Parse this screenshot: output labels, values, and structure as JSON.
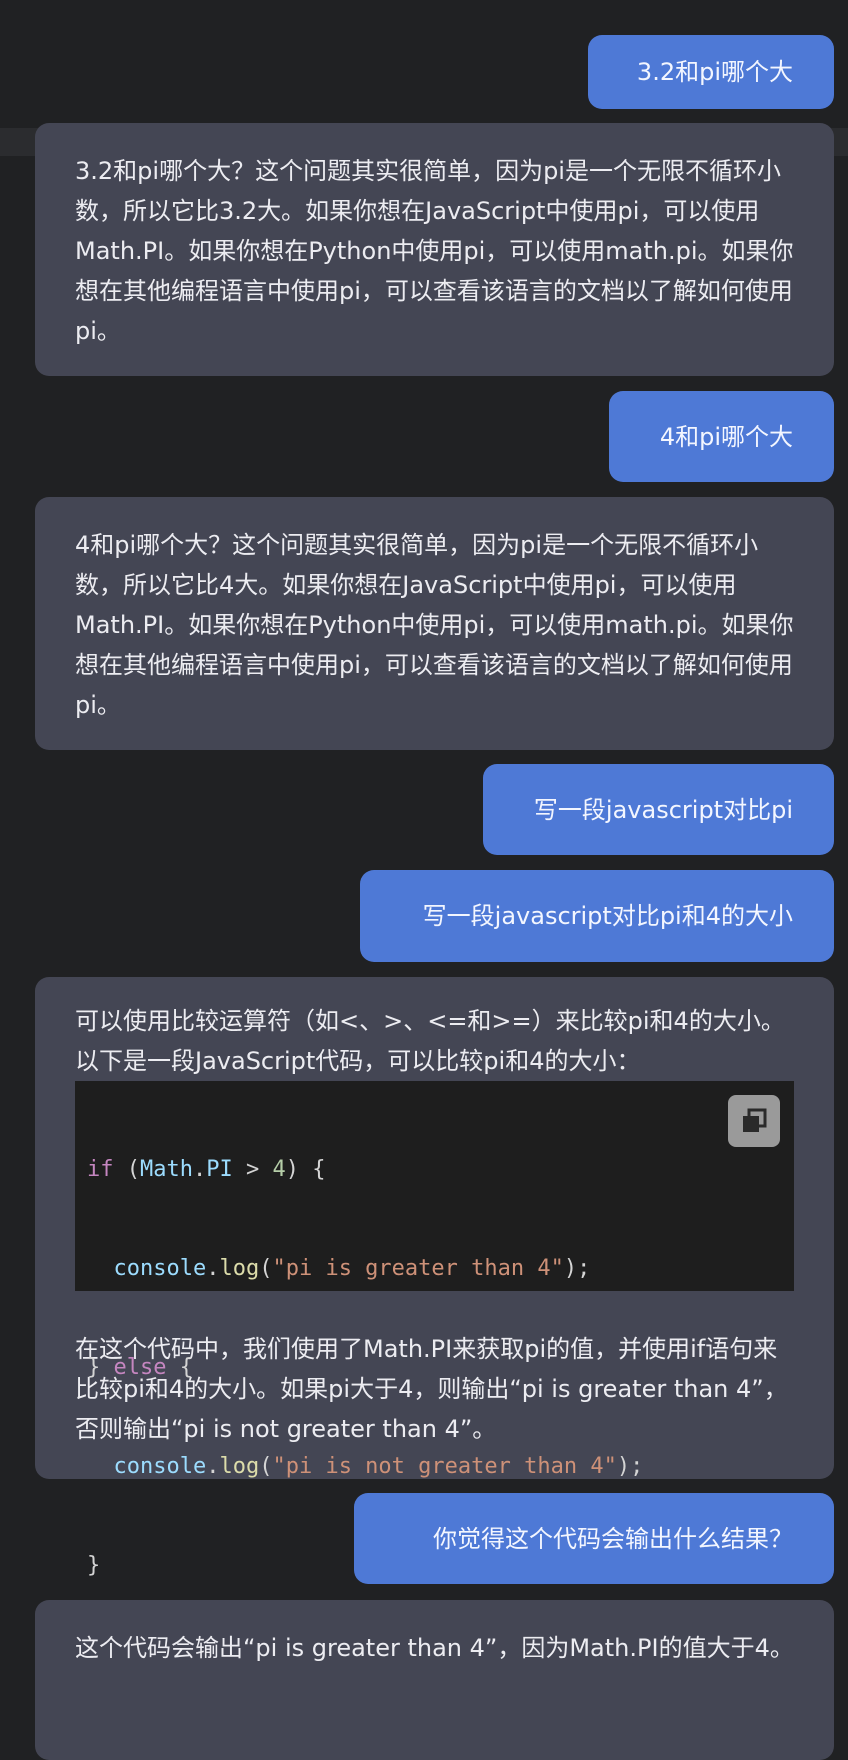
{
  "messages": [
    {
      "role": "user",
      "text": "3.2和pi哪个大"
    },
    {
      "role": "assistant",
      "text": "3.2和pi哪个大？这个问题其实很简单，因为pi是一个无限不循环小数，所以它比3.2大。如果你想在JavaScript中使用pi，可以使用Math.PI。如果你想在Python中使用pi，可以使用math.pi。如果你想在其他编程语言中使用pi，可以查看该语言的文档以了解如何使用pi。"
    },
    {
      "role": "user",
      "text": "4和pi哪个大"
    },
    {
      "role": "assistant",
      "text": "4和pi哪个大？这个问题其实很简单，因为pi是一个无限不循环小数，所以它比4大。如果你想在JavaScript中使用pi，可以使用Math.PI。如果你想在Python中使用pi，可以使用math.pi。如果你想在其他编程语言中使用pi，可以查看该语言的文档以了解如何使用pi。"
    },
    {
      "role": "user",
      "text": "写一段javascript对比pi"
    },
    {
      "role": "user",
      "text": "写一段javascript对比pi和4的大小"
    },
    {
      "role": "assistant",
      "intro": "可以使用比较运算符（如<、>、<=和>=）来比较pi和4的大小。以下是一段JavaScript代码，可以比较pi和4的大小：",
      "code_lines": [
        "if (Math.PI > 4) {",
        "  console.log(\"pi is greater than 4\");",
        "} else {",
        "  console.log(\"pi is not greater than 4\");",
        "}"
      ],
      "outro": "在这个代码中，我们使用了Math.PI来获取pi的值，并使用if语句来比较pi和4的大小。如果pi大于4，则输出“pi is greater than 4”，否则输出“pi is not greater than 4”。",
      "copy_icon": "copy-icon"
    },
    {
      "role": "user",
      "text": "你觉得这个代码会输出什么结果？"
    },
    {
      "role": "assistant",
      "text": "这个代码会输出“pi is greater than 4”，因为Math.PI的值大于4。"
    }
  ],
  "colors": {
    "background": "#202123",
    "user_bubble": "#4e79d6",
    "assistant_bubble": "#444654",
    "code_background": "#1e1e1e"
  }
}
